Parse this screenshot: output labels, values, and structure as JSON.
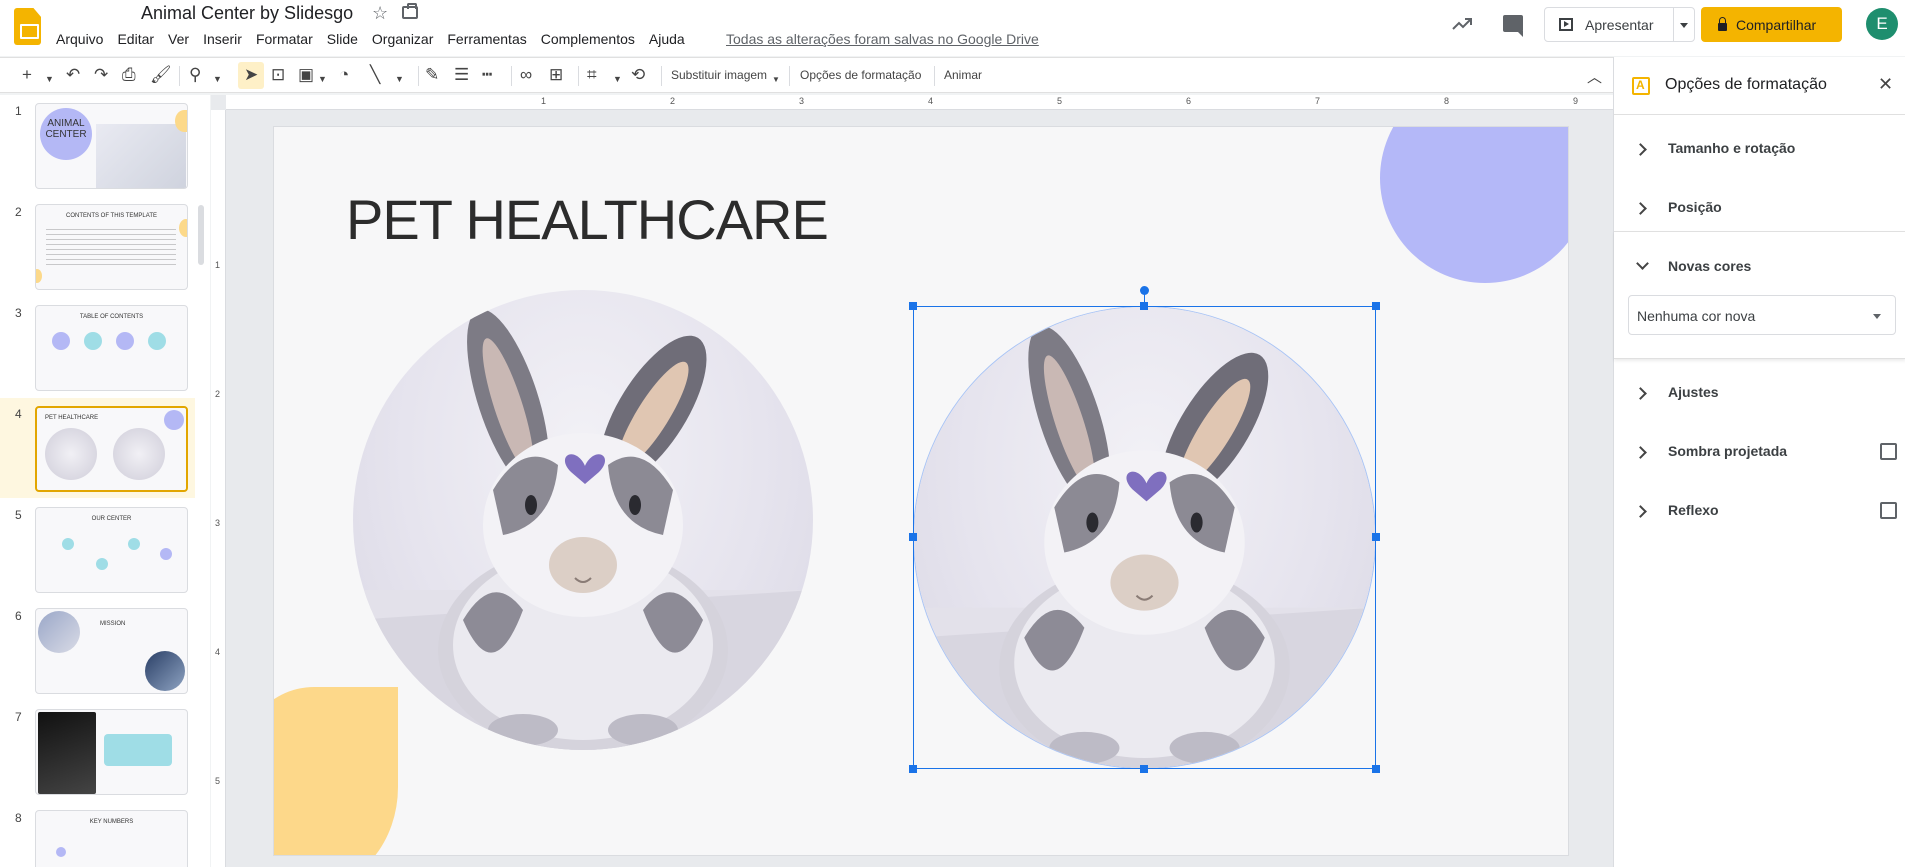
{
  "app": {
    "title": "Animal Center by Slidesgo",
    "saved_status": "Todas as alterações foram salvas no Google Drive",
    "brand_color": "#f4b400",
    "avatar_letter": "E"
  },
  "menu": [
    "Arquivo",
    "Editar",
    "Ver",
    "Inserir",
    "Formatar",
    "Slide",
    "Organizar",
    "Ferramentas",
    "Complementos",
    "Ajuda"
  ],
  "header": {
    "present_label": "Apresentar",
    "share_label": "Compartilhar"
  },
  "toolbar": {
    "replace_image": "Substituir imagem",
    "format_options": "Opções de formatação",
    "animate": "Animar"
  },
  "ruler": {
    "h_labels": [
      "1",
      "2",
      "3",
      "4",
      "5",
      "6",
      "7",
      "8",
      "9"
    ],
    "v_labels": [
      "1",
      "2",
      "3",
      "4",
      "5"
    ]
  },
  "slides": [
    {
      "num": "1",
      "title": "ANIMAL CENTER"
    },
    {
      "num": "2",
      "title": "CONTENTS OF THIS TEMPLATE"
    },
    {
      "num": "3",
      "title": "TABLE OF CONTENTS"
    },
    {
      "num": "4",
      "title": "PET HEALTHCARE"
    },
    {
      "num": "5",
      "title": "OUR CENTER"
    },
    {
      "num": "6",
      "title": "MISSION"
    },
    {
      "num": "7",
      "title": ""
    },
    {
      "num": "8",
      "title": "KEY NUMBERS"
    }
  ],
  "selected_slide": 4,
  "slide": {
    "title": "PET HEALTHCARE"
  },
  "panel": {
    "title": "Opções de formatação",
    "sections": {
      "size": "Tamanho e rotação",
      "position": "Posição",
      "recolor": "Novas cores",
      "adjust": "Ajustes",
      "shadow": "Sombra projetada",
      "reflection": "Reflexo"
    },
    "recolor_value": "Nenhuma cor nova"
  }
}
